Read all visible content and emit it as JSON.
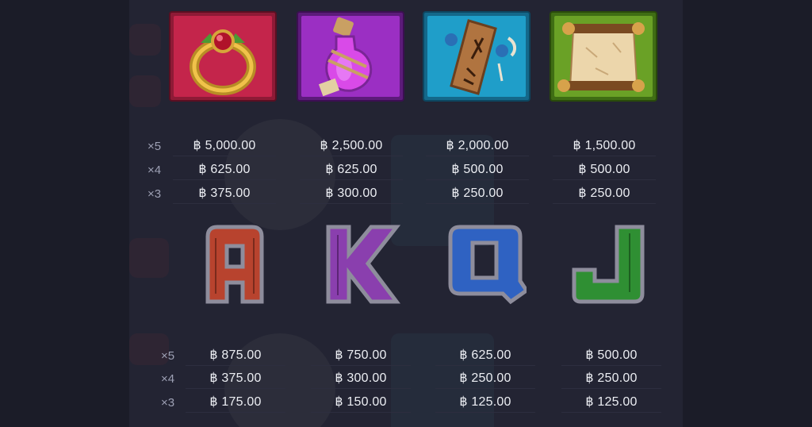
{
  "currency": "฿",
  "multipliers": [
    "×5",
    "×4",
    "×3"
  ],
  "premium_symbols": [
    {
      "icon": "ring-icon",
      "color": "#c4254b",
      "payouts": [
        "฿ 5,000.00",
        "฿ 625.00",
        "฿ 375.00"
      ]
    },
    {
      "icon": "potion-icon",
      "color": "#9b2fc3",
      "payouts": [
        "฿ 2,500.00",
        "฿ 625.00",
        "฿ 300.00"
      ]
    },
    {
      "icon": "rune-log-icon",
      "color": "#1f9ec9",
      "payouts": [
        "฿ 2,000.00",
        "฿ 500.00",
        "฿ 250.00"
      ]
    },
    {
      "icon": "scroll-icon",
      "color": "#6aa126",
      "payouts": [
        "฿ 1,500.00",
        "฿ 500.00",
        "฿ 250.00"
      ]
    }
  ],
  "letter_symbols": [
    {
      "letter": "A",
      "icon": "letter-a-icon",
      "color": "#b8432e",
      "payouts": [
        "฿ 875.00",
        "฿ 375.00",
        "฿ 175.00"
      ]
    },
    {
      "letter": "K",
      "icon": "letter-k-icon",
      "color": "#8a3fae",
      "payouts": [
        "฿ 750.00",
        "฿ 300.00",
        "฿ 150.00"
      ]
    },
    {
      "letter": "Q",
      "icon": "letter-q-icon",
      "color": "#2f62c2",
      "payouts": [
        "฿ 625.00",
        "฿ 250.00",
        "฿ 125.00"
      ]
    },
    {
      "letter": "J",
      "icon": "letter-j-icon",
      "color": "#2f8f33",
      "payouts": [
        "฿ 500.00",
        "฿ 250.00",
        "฿ 125.00"
      ]
    }
  ]
}
